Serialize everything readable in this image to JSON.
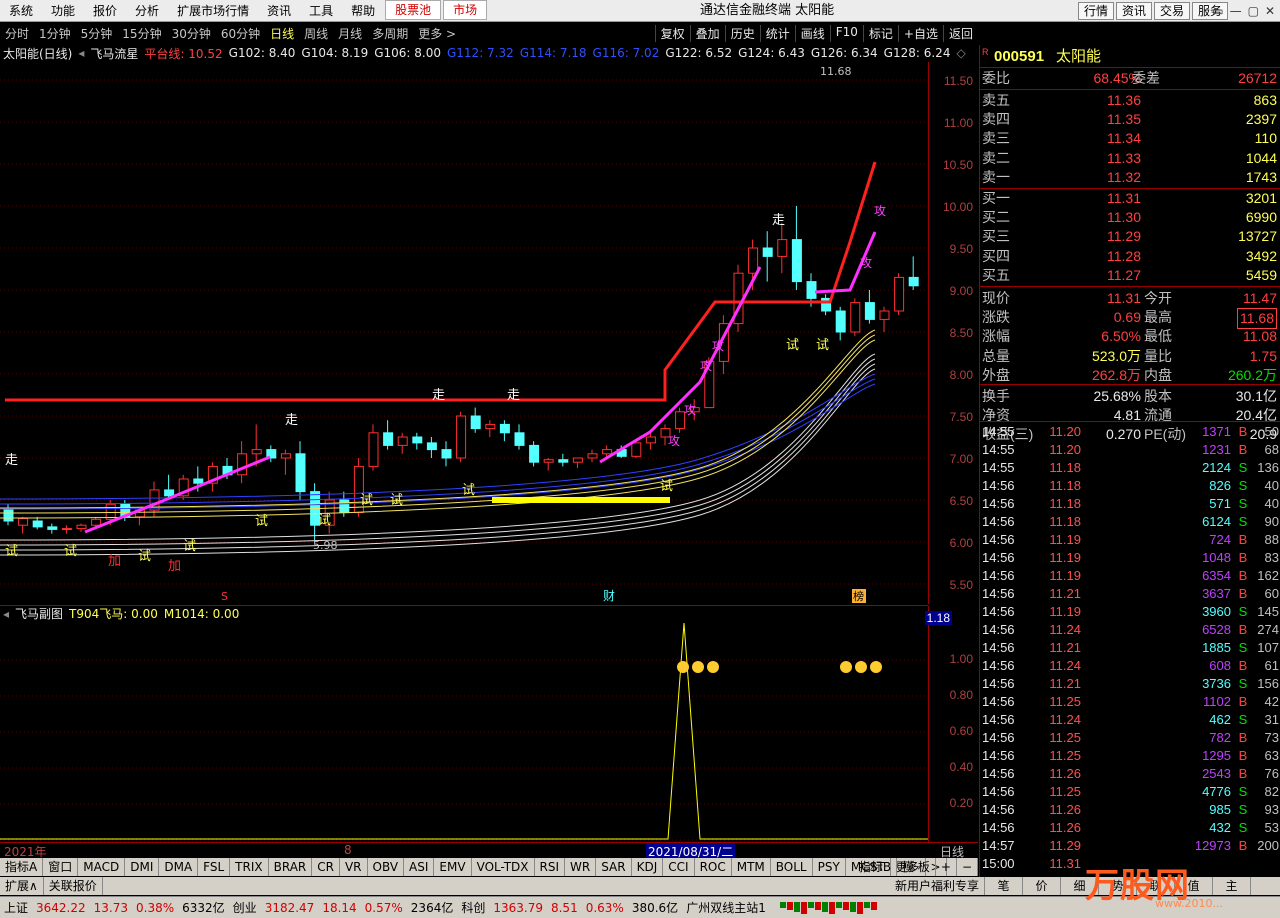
{
  "menu": {
    "items": [
      "系统",
      "功能",
      "报价",
      "分析",
      "扩展市场行情",
      "资讯",
      "工具",
      "帮助"
    ],
    "red_items": [
      "股票池",
      "市场"
    ],
    "title": "通达信金融终端  太阳能",
    "right": [
      "行情",
      "资讯",
      "交易",
      "服务"
    ],
    "win": [
      "▭",
      "—",
      "▢",
      "✕"
    ]
  },
  "periods": [
    "分时",
    "1分钟",
    "5分钟",
    "15分钟",
    "30分钟",
    "60分钟",
    "日线",
    "周线",
    "月线",
    "多周期",
    "更多 >"
  ],
  "selected_period": "日线",
  "toolbar": [
    "复权",
    "叠加",
    "历史",
    "统计",
    "画线",
    "F10",
    "标记",
    "+自选",
    "返回"
  ],
  "legend": {
    "name": "太阳能(日线)",
    "indicator": "飞马流星",
    "pingtai": "平台线: 10.52",
    "g": [
      {
        "t": "G102: 8.40",
        "c": "#e8e8e8"
      },
      {
        "t": "G104: 8.19",
        "c": "#e8e8e8"
      },
      {
        "t": "G106: 8.00",
        "c": "#e8e8e8"
      },
      {
        "t": "G112: 7.32",
        "c": "#3050ff"
      },
      {
        "t": "G114: 7.18",
        "c": "#3050ff"
      },
      {
        "t": "G116: 7.02",
        "c": "#3050ff"
      },
      {
        "t": "G122: 6.52",
        "c": "#e8e8e8"
      },
      {
        "t": "G124: 6.43",
        "c": "#e8e8e8"
      },
      {
        "t": "G126: 6.34",
        "c": "#e8e8e8"
      },
      {
        "t": "G128: 6.24",
        "c": "#e8e8e8"
      }
    ]
  },
  "axis1": [
    "11.50",
    "11.00",
    "10.50",
    "10.00",
    "9.50",
    "9.00",
    "8.50",
    "8.00",
    "7.50",
    "7.00",
    "6.50",
    "6.00",
    "5.50"
  ],
  "chart_labels": {
    "hi": "11.68",
    "lo": "5.98",
    "zou": "走",
    "shi": "试",
    "jia": "加",
    "gong": "攻",
    "cai": "财",
    "bang": "榜",
    "s": "S"
  },
  "sub": {
    "title": "飞马副图",
    "t904": "T904飞马: 0.00",
    "m1014": "M1014: 0.00",
    "axis": [
      "1.18",
      "1.00",
      "0.80",
      "0.60",
      "0.40",
      "0.20"
    ]
  },
  "dates": {
    "year": "2021年",
    "mon": "8",
    "cursor": "2021/08/31/二",
    "period": "日线"
  },
  "tabs": [
    "指标A",
    "窗口",
    "MACD",
    "DMI",
    "DMA",
    "FSL",
    "TRIX",
    "BRAR",
    "CR",
    "VR",
    "OBV",
    "ASI",
    "EMV",
    "VOL-TDX",
    "RSI",
    "WR",
    "SAR",
    "KDJ",
    "CCI",
    "ROC",
    "MTM",
    "BOLL",
    "PSY",
    "MCST",
    "更多",
    ">"
  ],
  "tabs_right": [
    "指标B",
    "模 板",
    "+",
    "−"
  ],
  "tabs2": [
    "扩展∧",
    "关联报价"
  ],
  "tabs2_right": [
    "新用户福利专享",
    "笔",
    "价",
    "细",
    "势",
    "联",
    "值",
    "主"
  ],
  "status": [
    {
      "t": "上证",
      "c": ""
    },
    {
      "t": "3642.22",
      "c": "sr"
    },
    {
      "t": "13.73",
      "c": "sr"
    },
    {
      "t": "0.38%",
      "c": "sr"
    },
    {
      "t": "6332亿",
      "c": ""
    },
    {
      "t": "创业",
      "c": ""
    },
    {
      "t": "3182.47",
      "c": "sr"
    },
    {
      "t": "18.14",
      "c": "sr"
    },
    {
      "t": "0.57%",
      "c": "sr"
    },
    {
      "t": "2364亿",
      "c": ""
    },
    {
      "t": "科创",
      "c": ""
    },
    {
      "t": "1363.79",
      "c": "sr"
    },
    {
      "t": "8.51",
      "c": "sr"
    },
    {
      "t": "0.63%",
      "c": "sr"
    },
    {
      "t": "380.6亿",
      "c": ""
    },
    {
      "t": "广州双线主站1",
      "c": ""
    }
  ],
  "stock": {
    "code": "000591",
    "name": "太阳能",
    "r": "R"
  },
  "weibi": {
    "l1": "委比",
    "v1": "68.45%",
    "l2": "委差",
    "v2": "26712"
  },
  "sell": [
    {
      "l": "卖五",
      "p": "11.36",
      "v": "863"
    },
    {
      "l": "卖四",
      "p": "11.35",
      "v": "2397"
    },
    {
      "l": "卖三",
      "p": "11.34",
      "v": "110"
    },
    {
      "l": "卖二",
      "p": "11.33",
      "v": "1044"
    },
    {
      "l": "卖一",
      "p": "11.32",
      "v": "1743"
    }
  ],
  "buy": [
    {
      "l": "买一",
      "p": "11.31",
      "v": "3201"
    },
    {
      "l": "买二",
      "p": "11.30",
      "v": "6990"
    },
    {
      "l": "买三",
      "p": "11.29",
      "v": "13727"
    },
    {
      "l": "买四",
      "p": "11.28",
      "v": "3492"
    },
    {
      "l": "买五",
      "p": "11.27",
      "v": "5459"
    }
  ],
  "quote": [
    {
      "l1": "现价",
      "v1": "11.31",
      "c1": "red",
      "l2": "今开",
      "v2": "11.47",
      "c2": "red"
    },
    {
      "l1": "涨跌",
      "v1": "0.69",
      "c1": "red",
      "l2": "最高",
      "v2": "11.68",
      "c2": "red"
    },
    {
      "l1": "涨幅",
      "v1": "6.50%",
      "c1": "red",
      "l2": "最低",
      "v2": "11.08",
      "c2": "red"
    },
    {
      "l1": "总量",
      "v1": "523.0万",
      "c1": "yellow",
      "l2": "量比",
      "v2": "1.75",
      "c2": "red"
    },
    {
      "l1": "外盘",
      "v1": "262.8万",
      "c1": "red",
      "l2": "内盘",
      "v2": "260.2万",
      "c2": "green"
    }
  ],
  "fund": [
    {
      "l1": "换手",
      "v1": "25.68%",
      "l2": "股本",
      "v2": "30.1亿"
    },
    {
      "l1": "净资",
      "v1": "4.81",
      "l2": "流通",
      "v2": "20.4亿"
    },
    {
      "l1": "收益(三)",
      "v1": "0.270",
      "l2": "PE(动)",
      "v2": "20.9"
    }
  ],
  "ticks": [
    [
      "14:55",
      "11.20",
      "1371",
      "B",
      "50"
    ],
    [
      "14:55",
      "11.20",
      "1231",
      "B",
      "68"
    ],
    [
      "14:55",
      "11.18",
      "2124",
      "S",
      "136"
    ],
    [
      "14:56",
      "11.18",
      "826",
      "S",
      "40"
    ],
    [
      "14:56",
      "11.18",
      "571",
      "S",
      "40"
    ],
    [
      "14:56",
      "11.18",
      "6124",
      "S",
      "90"
    ],
    [
      "14:56",
      "11.19",
      "724",
      "B",
      "88"
    ],
    [
      "14:56",
      "11.19",
      "1048",
      "B",
      "83"
    ],
    [
      "14:56",
      "11.19",
      "6354",
      "B",
      "162"
    ],
    [
      "14:56",
      "11.21",
      "3637",
      "B",
      "60"
    ],
    [
      "14:56",
      "11.19",
      "3960",
      "S",
      "145"
    ],
    [
      "14:56",
      "11.24",
      "6528",
      "B",
      "274"
    ],
    [
      "14:56",
      "11.21",
      "1885",
      "S",
      "107"
    ],
    [
      "14:56",
      "11.24",
      "608",
      "B",
      "61"
    ],
    [
      "14:56",
      "11.21",
      "3736",
      "S",
      "156"
    ],
    [
      "14:56",
      "11.25",
      "1102",
      "B",
      "42"
    ],
    [
      "14:56",
      "11.24",
      "462",
      "S",
      "31"
    ],
    [
      "14:56",
      "11.25",
      "782",
      "B",
      "73"
    ],
    [
      "14:56",
      "11.25",
      "1295",
      "B",
      "63"
    ],
    [
      "14:56",
      "11.26",
      "2543",
      "B",
      "76"
    ],
    [
      "14:56",
      "11.25",
      "4776",
      "S",
      "82"
    ],
    [
      "14:56",
      "11.26",
      "985",
      "S",
      "93"
    ],
    [
      "14:56",
      "11.26",
      "432",
      "S",
      "53"
    ],
    [
      "14:57",
      "11.29",
      "12973",
      "B",
      "200"
    ],
    [
      "15:00",
      "11.31",
      "",
      "",
      ""
    ]
  ],
  "watermark": {
    "brand": "万股网",
    "url": "www.2010..."
  }
}
